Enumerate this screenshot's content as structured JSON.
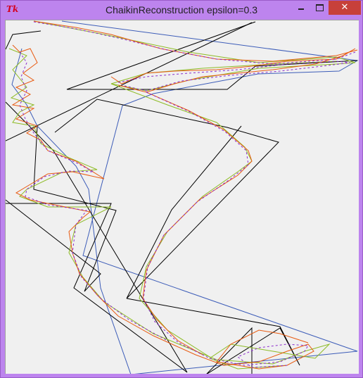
{
  "window": {
    "title": "ChaikinReconstruction epsilon=0.3",
    "icon": "tk-feather-icon",
    "icon_text": "Tk",
    "close_glyph": "✕"
  },
  "colors": {
    "titlebar": "#bd84ee",
    "canvas_bg": "#f0f0f0",
    "original_polyline": "#000000",
    "blue_polyline": "#3c5cb8",
    "curve_green": "#8dbb24",
    "curve_orange": "#e85a10",
    "curve_purple": "#8c2ccc"
  }
}
